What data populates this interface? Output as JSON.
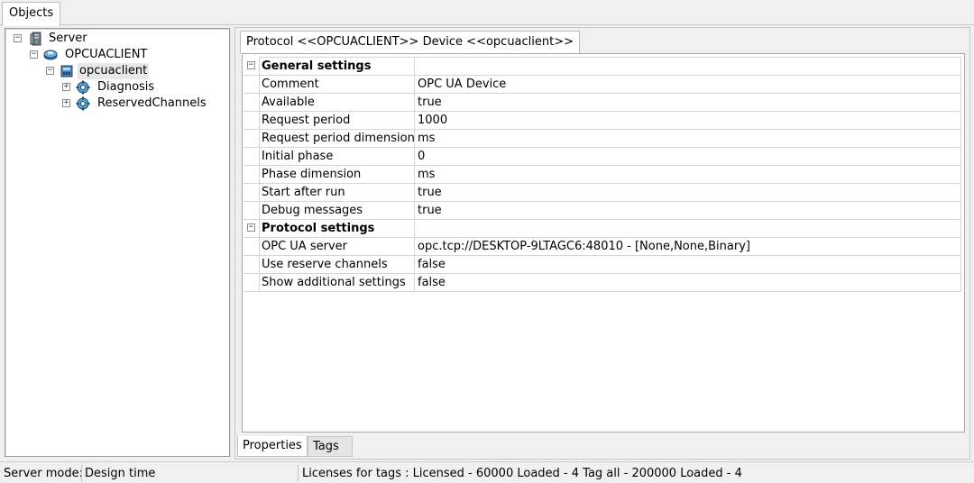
{
  "top_tabs": [
    {
      "label": "Objects"
    }
  ],
  "tree": {
    "nodes": [
      {
        "label": "Server",
        "toggle": "−",
        "icon": "server-icon"
      },
      {
        "label": "OPCUACLIENT",
        "toggle": "−",
        "icon": "driver-icon"
      },
      {
        "label": "opcuaclient",
        "toggle": "−",
        "icon": "device-icon",
        "selected": true
      },
      {
        "label": "Diagnosis",
        "toggle": "+",
        "icon": "channel-gear-icon"
      },
      {
        "label": "ReservedChannels",
        "toggle": "+",
        "icon": "channel-gear-icon"
      }
    ]
  },
  "document_tab": {
    "label": "Protocol <<OPCUACLIENT>> Device <<opcuaclient>>"
  },
  "properties": {
    "groups": [
      {
        "title": "General settings",
        "toggle": "−",
        "rows": [
          {
            "name": "Comment",
            "value": "OPC UA Device"
          },
          {
            "name": "Available",
            "value": "true"
          },
          {
            "name": "Request period",
            "value": "1000"
          },
          {
            "name": "Request period dimension",
            "value": "ms"
          },
          {
            "name": "Initial phase",
            "value": "0"
          },
          {
            "name": "Phase dimension",
            "value": "ms"
          },
          {
            "name": "Start after run",
            "value": "true"
          },
          {
            "name": "Debug messages",
            "value": "true"
          }
        ]
      },
      {
        "title": "Protocol settings",
        "toggle": "−",
        "rows": [
          {
            "name": "OPC UA server",
            "value": "opc.tcp://DESKTOP-9LTAGC6:48010 - [None,None,Binary]"
          },
          {
            "name": "Use reserve channels",
            "value": "false"
          },
          {
            "name": "Show additional settings",
            "value": "false"
          }
        ]
      }
    ]
  },
  "bottom_tabs": [
    {
      "label": "Properties",
      "active": true
    },
    {
      "label": "Tags",
      "active": false
    }
  ],
  "status": {
    "mode_label": "Server mode:",
    "mode_value": "Design time",
    "licenses": "Licenses for tags : Licensed - 60000  Loaded - 4 Tag all - 200000  Loaded - 4"
  },
  "colors": {
    "window_bg": "#f0f0f0",
    "grid_line": "#d4d4d4",
    "selection_bg": "#e8e8e8"
  }
}
